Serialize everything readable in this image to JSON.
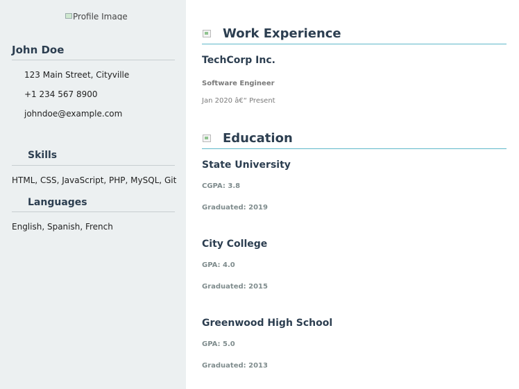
{
  "sidebar": {
    "profile_image_alt": "Profile Image",
    "name": "John Doe",
    "contact": {
      "address": "123 Main Street, Cityville",
      "phone": "+1 234 567 8900",
      "email": "johndoe@example.com"
    },
    "skills": {
      "title": "Skills",
      "text": "HTML, CSS, JavaScript, PHP, MySQL, Git"
    },
    "languages": {
      "title": "Languages",
      "text": "English, Spanish, French"
    }
  },
  "main": {
    "work": {
      "title": "Work Experience",
      "entries": [
        {
          "company": "TechCorp Inc.",
          "role": "Software Engineer",
          "dates": "Jan 2020 â€“ Present"
        }
      ]
    },
    "education": {
      "title": "Education",
      "entries": [
        {
          "school": "State University",
          "score": "CGPA: 3.8",
          "graduated": "Graduated: 2019"
        },
        {
          "school": "City College",
          "score": "GPA: 4.0",
          "graduated": "Graduated: 2015"
        },
        {
          "school": "Greenwood High School",
          "score": "GPA: 5.0",
          "graduated": "Graduated: 2013"
        }
      ]
    }
  },
  "colors": {
    "sidebar_bg": "#ecf0f1",
    "heading": "#2c3e50",
    "accent_rule": "#5db8c9",
    "muted": "#7f8c8d"
  }
}
